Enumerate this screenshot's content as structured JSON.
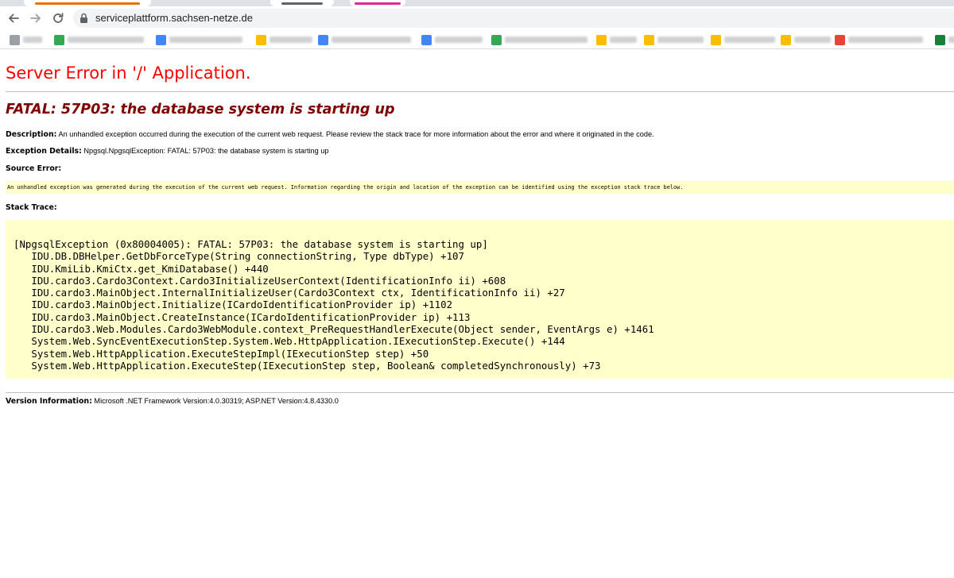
{
  "browser": {
    "url": "serviceplattform.sachsen-netze.de",
    "tab_colors": [
      "#e8710a",
      "#5f6368",
      "#e52592"
    ],
    "bookmark_icon_colors": [
      "#9aa0a6",
      "#34a853",
      "#4285f4",
      "#fbbc04",
      "#4285f4",
      "#4285f4",
      "#34a853",
      "#fbbc04",
      "#fbbc04",
      "#fbbc04",
      "#fbbc04",
      "#ea4335",
      "#188038"
    ]
  },
  "page": {
    "title": "Server Error in '/' Application.",
    "error_heading": "FATAL: 57P03: the database system is starting up",
    "description_label": "Description:",
    "description_text": "An unhandled exception occurred during the execution of the current web request. Please review the stack trace for more information about the error and where it originated in the code.",
    "exception_label": "Exception Details:",
    "exception_text": "Npgsql.NpgsqlException: FATAL: 57P03: the database system is starting up",
    "source_error_label": "Source Error:",
    "source_error_text": "An unhandled exception was generated during the execution of the current web request. Information regarding the origin and location of the exception can be identified using the exception stack trace below.",
    "stack_trace_label": "Stack Trace:",
    "stack_trace": "[NpgsqlException (0x80004005): FATAL: 57P03: the database system is starting up]\n   IDU.DB.DBHelper.GetDbForceType(String connectionString, Type dbType) +107\n   IDU.KmiLib.KmiCtx.get_KmiDatabase() +440\n   IDU.cardo3.Cardo3Context.Cardo3InitializeUserContext(IdentificationInfo ii) +608\n   IDU.cardo3.MainObject.InternalInitializeUser(Cardo3Context ctx, IdentificationInfo ii) +27\n   IDU.cardo3.MainObject.Initialize(ICardoIdentificationProvider ip) +1102\n   IDU.cardo3.MainObject.CreateInstance(ICardoIdentificationProvider ip) +113\n   IDU.cardo3.Web.Modules.Cardo3WebModule.context_PreRequestHandlerExecute(Object sender, EventArgs e) +1461\n   System.Web.SyncEventExecutionStep.System.Web.HttpApplication.IExecutionStep.Execute() +144\n   System.Web.HttpApplication.ExecuteStepImpl(IExecutionStep step) +50\n   System.Web.HttpApplication.ExecuteStep(IExecutionStep step, Boolean& completedSynchronously) +73",
    "version_label": "Version Information:",
    "version_text": "Microsoft .NET Framework Version:4.0.30319; ASP.NET Version:4.8.4330.0"
  }
}
